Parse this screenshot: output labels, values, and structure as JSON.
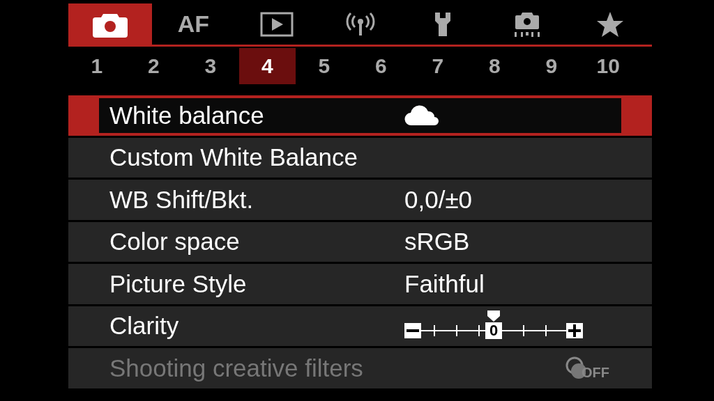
{
  "tabs": [
    {
      "kind": "camera",
      "selected": true
    },
    {
      "kind": "text",
      "label": "AF",
      "selected": false
    },
    {
      "kind": "play",
      "selected": false
    },
    {
      "kind": "wireless",
      "selected": false
    },
    {
      "kind": "wrench",
      "selected": false
    },
    {
      "kind": "custom",
      "selected": false
    },
    {
      "kind": "star",
      "selected": false
    }
  ],
  "pages": [
    {
      "label": "1",
      "selected": false
    },
    {
      "label": "2",
      "selected": false
    },
    {
      "label": "3",
      "selected": false
    },
    {
      "label": "4",
      "selected": true
    },
    {
      "label": "5",
      "selected": false
    },
    {
      "label": "6",
      "selected": false
    },
    {
      "label": "7",
      "selected": false
    },
    {
      "label": "8",
      "selected": false
    },
    {
      "label": "9",
      "selected": false
    },
    {
      "label": "10",
      "selected": false
    }
  ],
  "menu": [
    {
      "label": "White balance",
      "kind": "cloud",
      "selected": true,
      "disabled": false
    },
    {
      "label": "Custom White Balance",
      "kind": "none",
      "selected": false,
      "disabled": false
    },
    {
      "label": "WB Shift/Bkt.",
      "kind": "text",
      "value": "0,0/±0",
      "selected": false,
      "disabled": false
    },
    {
      "label": "Color space",
      "kind": "text",
      "value": "sRGB",
      "selected": false,
      "disabled": false
    },
    {
      "label": "Picture Style",
      "kind": "text",
      "value": "Faithful",
      "selected": false,
      "disabled": false
    },
    {
      "label": "Clarity",
      "kind": "scale",
      "center": "0",
      "level": 0.5,
      "selected": false,
      "disabled": false
    },
    {
      "label": "Shooting creative filters",
      "kind": "filter",
      "value": "OFF",
      "selected": false,
      "disabled": true
    }
  ]
}
